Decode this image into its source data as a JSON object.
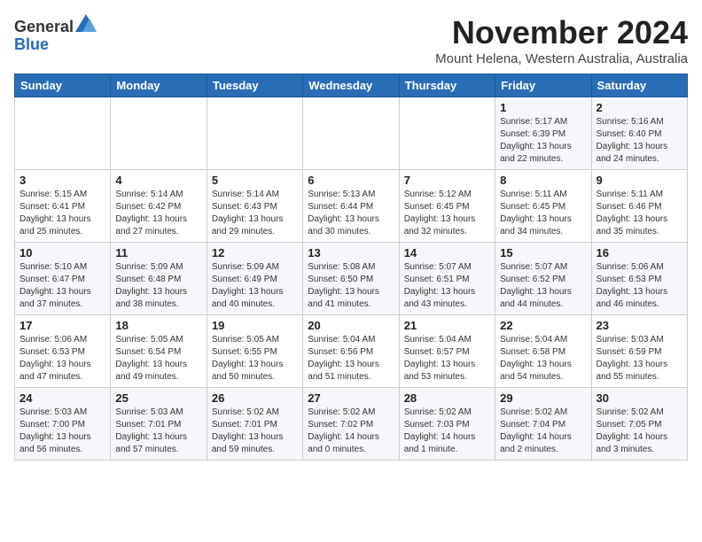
{
  "header": {
    "logo": {
      "general": "General",
      "blue": "Blue"
    },
    "title": "November 2024",
    "location": "Mount Helena, Western Australia, Australia"
  },
  "weekdays": [
    "Sunday",
    "Monday",
    "Tuesday",
    "Wednesday",
    "Thursday",
    "Friday",
    "Saturday"
  ],
  "weeks": [
    [
      {
        "day": "",
        "text": ""
      },
      {
        "day": "",
        "text": ""
      },
      {
        "day": "",
        "text": ""
      },
      {
        "day": "",
        "text": ""
      },
      {
        "day": "",
        "text": ""
      },
      {
        "day": "1",
        "text": "Sunrise: 5:17 AM\nSunset: 6:39 PM\nDaylight: 13 hours\nand 22 minutes."
      },
      {
        "day": "2",
        "text": "Sunrise: 5:16 AM\nSunset: 6:40 PM\nDaylight: 13 hours\nand 24 minutes."
      }
    ],
    [
      {
        "day": "3",
        "text": "Sunrise: 5:15 AM\nSunset: 6:41 PM\nDaylight: 13 hours\nand 25 minutes."
      },
      {
        "day": "4",
        "text": "Sunrise: 5:14 AM\nSunset: 6:42 PM\nDaylight: 13 hours\nand 27 minutes."
      },
      {
        "day": "5",
        "text": "Sunrise: 5:14 AM\nSunset: 6:43 PM\nDaylight: 13 hours\nand 29 minutes."
      },
      {
        "day": "6",
        "text": "Sunrise: 5:13 AM\nSunset: 6:44 PM\nDaylight: 13 hours\nand 30 minutes."
      },
      {
        "day": "7",
        "text": "Sunrise: 5:12 AM\nSunset: 6:45 PM\nDaylight: 13 hours\nand 32 minutes."
      },
      {
        "day": "8",
        "text": "Sunrise: 5:11 AM\nSunset: 6:45 PM\nDaylight: 13 hours\nand 34 minutes."
      },
      {
        "day": "9",
        "text": "Sunrise: 5:11 AM\nSunset: 6:46 PM\nDaylight: 13 hours\nand 35 minutes."
      }
    ],
    [
      {
        "day": "10",
        "text": "Sunrise: 5:10 AM\nSunset: 6:47 PM\nDaylight: 13 hours\nand 37 minutes."
      },
      {
        "day": "11",
        "text": "Sunrise: 5:09 AM\nSunset: 6:48 PM\nDaylight: 13 hours\nand 38 minutes."
      },
      {
        "day": "12",
        "text": "Sunrise: 5:09 AM\nSunset: 6:49 PM\nDaylight: 13 hours\nand 40 minutes."
      },
      {
        "day": "13",
        "text": "Sunrise: 5:08 AM\nSunset: 6:50 PM\nDaylight: 13 hours\nand 41 minutes."
      },
      {
        "day": "14",
        "text": "Sunrise: 5:07 AM\nSunset: 6:51 PM\nDaylight: 13 hours\nand 43 minutes."
      },
      {
        "day": "15",
        "text": "Sunrise: 5:07 AM\nSunset: 6:52 PM\nDaylight: 13 hours\nand 44 minutes."
      },
      {
        "day": "16",
        "text": "Sunrise: 5:06 AM\nSunset: 6:53 PM\nDaylight: 13 hours\nand 46 minutes."
      }
    ],
    [
      {
        "day": "17",
        "text": "Sunrise: 5:06 AM\nSunset: 6:53 PM\nDaylight: 13 hours\nand 47 minutes."
      },
      {
        "day": "18",
        "text": "Sunrise: 5:05 AM\nSunset: 6:54 PM\nDaylight: 13 hours\nand 49 minutes."
      },
      {
        "day": "19",
        "text": "Sunrise: 5:05 AM\nSunset: 6:55 PM\nDaylight: 13 hours\nand 50 minutes."
      },
      {
        "day": "20",
        "text": "Sunrise: 5:04 AM\nSunset: 6:56 PM\nDaylight: 13 hours\nand 51 minutes."
      },
      {
        "day": "21",
        "text": "Sunrise: 5:04 AM\nSunset: 6:57 PM\nDaylight: 13 hours\nand 53 minutes."
      },
      {
        "day": "22",
        "text": "Sunrise: 5:04 AM\nSunset: 6:58 PM\nDaylight: 13 hours\nand 54 minutes."
      },
      {
        "day": "23",
        "text": "Sunrise: 5:03 AM\nSunset: 6:59 PM\nDaylight: 13 hours\nand 55 minutes."
      }
    ],
    [
      {
        "day": "24",
        "text": "Sunrise: 5:03 AM\nSunset: 7:00 PM\nDaylight: 13 hours\nand 56 minutes."
      },
      {
        "day": "25",
        "text": "Sunrise: 5:03 AM\nSunset: 7:01 PM\nDaylight: 13 hours\nand 57 minutes."
      },
      {
        "day": "26",
        "text": "Sunrise: 5:02 AM\nSunset: 7:01 PM\nDaylight: 13 hours\nand 59 minutes."
      },
      {
        "day": "27",
        "text": "Sunrise: 5:02 AM\nSunset: 7:02 PM\nDaylight: 14 hours\nand 0 minutes."
      },
      {
        "day": "28",
        "text": "Sunrise: 5:02 AM\nSunset: 7:03 PM\nDaylight: 14 hours\nand 1 minute."
      },
      {
        "day": "29",
        "text": "Sunrise: 5:02 AM\nSunset: 7:04 PM\nDaylight: 14 hours\nand 2 minutes."
      },
      {
        "day": "30",
        "text": "Sunrise: 5:02 AM\nSunset: 7:05 PM\nDaylight: 14 hours\nand 3 minutes."
      }
    ]
  ]
}
